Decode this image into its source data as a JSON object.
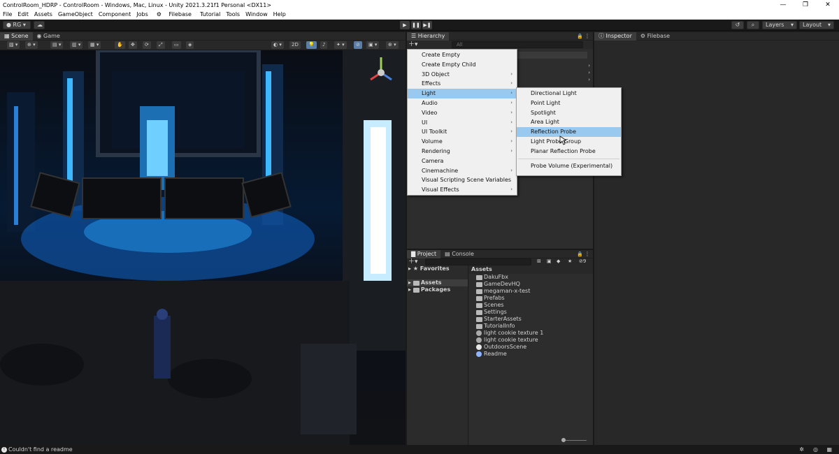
{
  "window": {
    "title": "ControlRoom_HDRP - ControlRoom - Windows, Mac, Linux - Unity 2021.3.21f1 Personal <DX11>",
    "controls": [
      "—",
      "❐",
      "✕"
    ]
  },
  "menubar": [
    "File",
    "Edit",
    "Assets",
    "GameObject",
    "Component",
    "Jobs",
    "Filebase",
    "Tutorial",
    "Tools",
    "Window",
    "Help"
  ],
  "toolbar": {
    "account": "RG",
    "layers": "Layers",
    "layout": "Layout",
    "play_icons": [
      "▶",
      "❚❚",
      "▶❚"
    ]
  },
  "scene_tabs": [
    "Scene",
    "Game"
  ],
  "scene_toolbar": {
    "mode_2d": "2D"
  },
  "hierarchy": {
    "tab": "Hierarchy",
    "search_placeholder": "All"
  },
  "gameobject_menu": {
    "items": [
      {
        "label": "Create Empty",
        "submenu": false
      },
      {
        "label": "Create Empty Child",
        "submenu": false
      },
      {
        "label": "3D Object",
        "submenu": true
      },
      {
        "label": "Effects",
        "submenu": true
      },
      {
        "label": "Light",
        "submenu": true,
        "highlighted": true
      },
      {
        "label": "Audio",
        "submenu": true
      },
      {
        "label": "Video",
        "submenu": true
      },
      {
        "label": "UI",
        "submenu": true
      },
      {
        "label": "UI Toolkit",
        "submenu": true
      },
      {
        "label": "Volume",
        "submenu": true
      },
      {
        "label": "Rendering",
        "submenu": true
      },
      {
        "label": "Camera",
        "submenu": false
      },
      {
        "label": "Cinemachine",
        "submenu": true
      },
      {
        "label": "Visual Scripting Scene Variables",
        "submenu": false
      },
      {
        "label": "Visual Effects",
        "submenu": true
      }
    ]
  },
  "light_submenu": {
    "items": [
      "Directional Light",
      "Point Light",
      "Spotlight",
      "Area Light",
      "Reflection Probe",
      "Light Probe Group",
      "Planar Reflection Probe",
      "Probe Volume (Experimental)"
    ],
    "highlighted": "Reflection Probe"
  },
  "project": {
    "tabs": [
      "Project",
      "Console"
    ],
    "hidden_count": "9",
    "favorites": "Favorites",
    "tree": [
      "Assets",
      "Packages"
    ],
    "breadcrumb": "Assets",
    "assets": [
      {
        "name": "DakuFbx",
        "icon": "folder-icon"
      },
      {
        "name": "GameDevHQ",
        "icon": "folder-icon"
      },
      {
        "name": "megaman-x-test",
        "icon": "folder-icon"
      },
      {
        "name": "Prefabs",
        "icon": "folder-icon"
      },
      {
        "name": "Scenes",
        "icon": "folder-icon"
      },
      {
        "name": "Settings",
        "icon": "folder-icon"
      },
      {
        "name": "StarterAssets",
        "icon": "folder-icon"
      },
      {
        "name": "TutorialInfo",
        "icon": "folder-icon"
      },
      {
        "name": "light cookie texture 1",
        "icon": "texture-icon"
      },
      {
        "name": "light cookie texture",
        "icon": "texture-icon"
      },
      {
        "name": "OutdoorsScene",
        "icon": "unity-scene-icon"
      },
      {
        "name": "Readme",
        "icon": "readme-icon"
      }
    ]
  },
  "inspector": {
    "tabs": [
      "Inspector",
      "Filebase"
    ]
  },
  "status": {
    "message": "Couldn't find a readme"
  },
  "colors": {
    "menu_highlight": "#99c9ef",
    "panel": "#282828",
    "selection": "#4d4d4d"
  }
}
